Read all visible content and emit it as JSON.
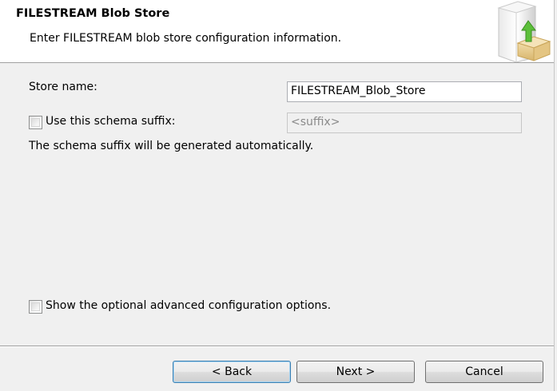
{
  "header": {
    "title": "FILESTREAM Blob Store",
    "subtitle": "Enter FILESTREAM blob store configuration information.",
    "icon": "database-server-package-icon"
  },
  "form": {
    "store_name_label": "Store name:",
    "store_name_value": "FILESTREAM_Blob_Store",
    "schema_suffix_label": "Use this schema suffix:",
    "schema_suffix_checked": false,
    "schema_suffix_placeholder": "<suffix>",
    "schema_suffix_note": "The schema suffix will be generated automatically.",
    "advanced_label": "Show the optional advanced configuration options.",
    "advanced_checked": false
  },
  "buttons": {
    "back": "< Back",
    "next": "Next  >",
    "cancel": "Cancel"
  }
}
